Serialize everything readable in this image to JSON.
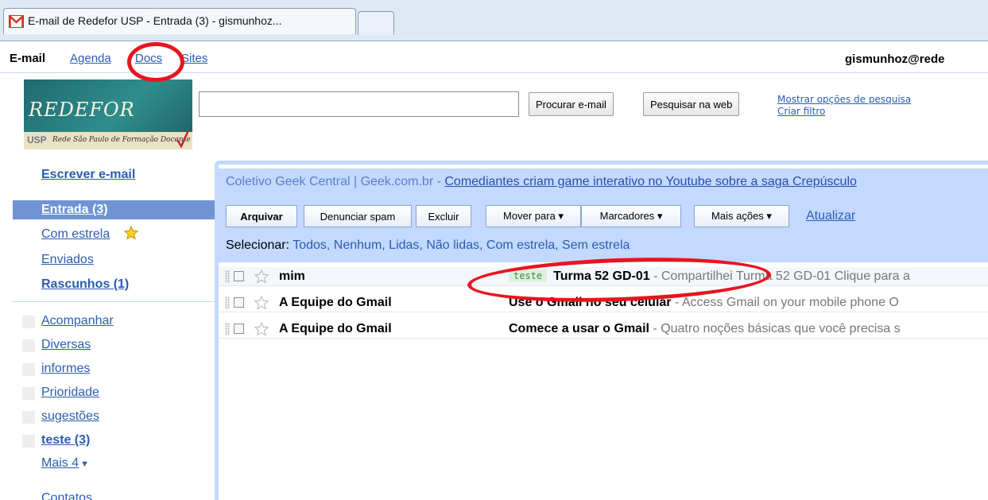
{
  "browser": {
    "tab_title": "E-mail de Redefor USP - Entrada (3) - gismunhoz..."
  },
  "topnav": {
    "current": "E-mail",
    "links": [
      "Agenda",
      "Docs",
      "Sites"
    ],
    "user_email": "gismunhoz@rede"
  },
  "logo": {
    "name": "REDEFOR",
    "usp": "USP",
    "tagline": "Rede São Paulo de Formação Docente"
  },
  "search": {
    "value": "",
    "search_mail_label": "Procurar e-mail",
    "search_web_label": "Pesquisar na web",
    "show_options": "Mostrar opções de pesquisa",
    "create_filter": "Criar filtro"
  },
  "sidebar": {
    "compose": "Escrever e-mail",
    "inbox": "Entrada (3)",
    "starred": "Com estrela",
    "sent": "Enviados",
    "drafts": "Rascunhos (1)",
    "labels": [
      "Acompanhar",
      "Diversas",
      "informes",
      "Prioridade",
      "sugestões",
      "teste (3)"
    ],
    "more": "Mais 4",
    "contacts": "Contatos"
  },
  "webclip": {
    "source": "Coletivo Geek Central | Geek.com.br - ",
    "headline": "Comediantes criam game interativo no Youtube sobre a saga Crepúsculo"
  },
  "toolbar": {
    "archive": "Arquivar",
    "spam": "Denunciar spam",
    "delete": "Excluir",
    "move_to": "Mover para ▾",
    "labels": "Marcadores ▾",
    "more_actions": "Mais ações ▾",
    "refresh": "Atualizar"
  },
  "select": {
    "label": "Selecionar:",
    "all": "Todos",
    "none": "Nenhum",
    "read": "Lidas",
    "unread": "Não lidas",
    "starred": "Com estrela",
    "unstarred": "Sem estrela"
  },
  "emails": [
    {
      "sender": "mim",
      "tag": "teste",
      "subject": "Turma 52 GD-01",
      "snippet": " - Compartilhei Turma 52 GD-01 Clique para a",
      "read": true
    },
    {
      "sender": "A Equipe do Gmail",
      "tag": "",
      "subject": "Use o Gmail no seu celular",
      "snippet": " - Access Gmail on your mobile phone O",
      "read": false
    },
    {
      "sender": "A Equipe do Gmail",
      "tag": "",
      "subject": "Comece a usar o Gmail",
      "snippet": " - Quatro noções básicas que você precisa s",
      "read": false
    }
  ],
  "colors": {
    "link": "#2a5db0",
    "panel": "#c3d9ff",
    "selected_nav": "#6f93d3",
    "annotation": "#e8141e",
    "gmail_red": "#d93025"
  }
}
